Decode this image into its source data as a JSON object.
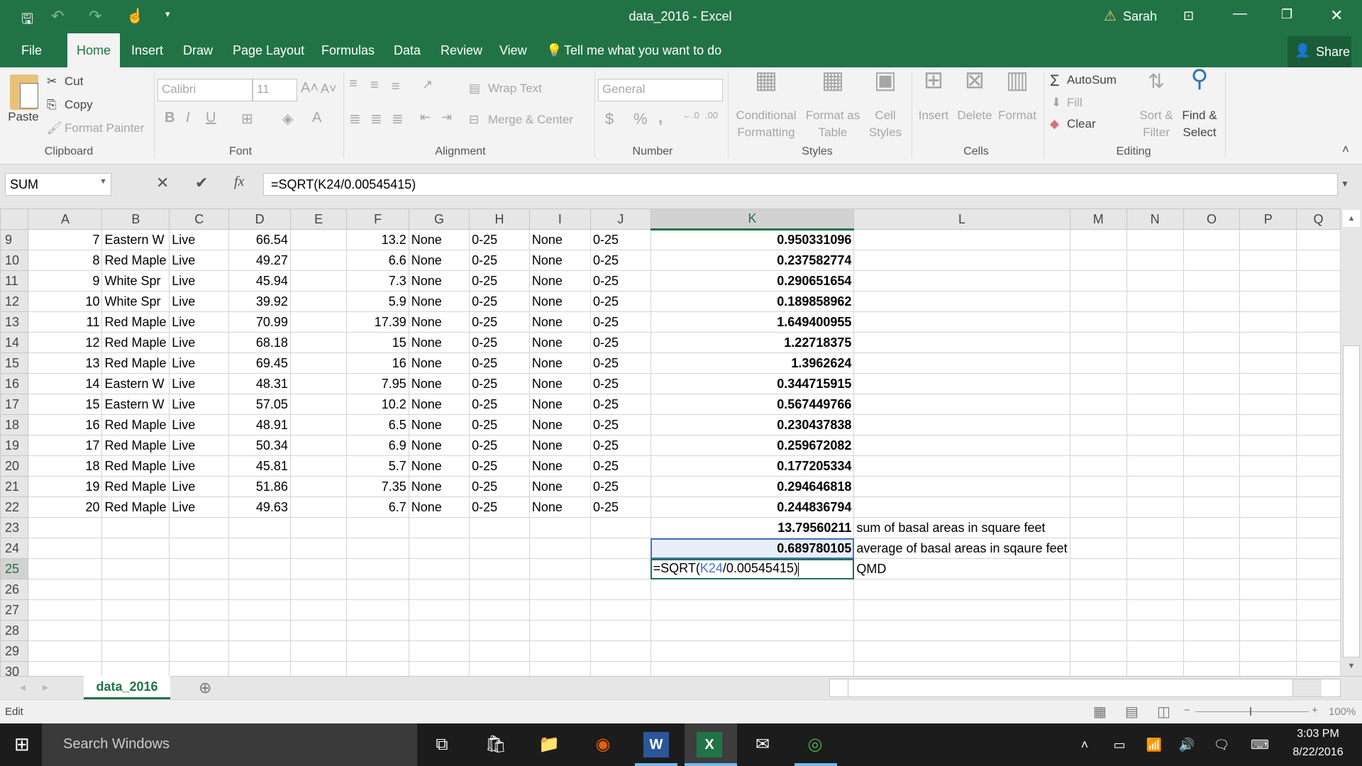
{
  "window": {
    "title": "data_2016 - Excel",
    "user": "Sarah"
  },
  "menu": {
    "file": "File",
    "tabs": [
      "Home",
      "Insert",
      "Draw",
      "Page Layout",
      "Formulas",
      "Data",
      "Review",
      "View"
    ],
    "tell_me": "Tell me what you want to do",
    "share": "Share"
  },
  "ribbon": {
    "clipboard": {
      "label": "Clipboard",
      "paste": "Paste",
      "cut": "Cut",
      "copy": "Copy",
      "format_painter": "Format Painter"
    },
    "font": {
      "label": "Font",
      "name": "Calibri",
      "size": "11"
    },
    "alignment": {
      "label": "Alignment",
      "wrap_text": "Wrap Text",
      "merge_center": "Merge & Center"
    },
    "number": {
      "label": "Number",
      "format": "General"
    },
    "styles": {
      "label": "Styles",
      "conditional": "Conditional",
      "conditional2": "Formatting",
      "format_as": "Format as",
      "format_as2": "Table",
      "cell": "Cell",
      "cell2": "Styles"
    },
    "cells": {
      "label": "Cells",
      "insert": "Insert",
      "delete": "Delete",
      "format": "Format"
    },
    "editing": {
      "label": "Editing",
      "autosum": "AutoSum",
      "fill": "Fill",
      "clear": "Clear",
      "sort": "Sort &",
      "sort2": "Filter",
      "find": "Find &",
      "find2": "Select"
    }
  },
  "formula_bar": {
    "name_box": "SUM",
    "formula": "=SQRT(K24/0.00545415)"
  },
  "sheet": {
    "columns": [
      "A",
      "B",
      "C",
      "D",
      "E",
      "F",
      "G",
      "H",
      "I",
      "J",
      "K",
      "L",
      "M",
      "N",
      "O",
      "P",
      "Q"
    ],
    "selected_column": "K",
    "active_row": "25",
    "rows": [
      {
        "n": "9",
        "A": "7",
        "B": "Eastern W",
        "C": "Live",
        "D": "66.54",
        "F": "13.2",
        "G": "None",
        "H": "0-25",
        "I": "None",
        "J": "0-25",
        "K": "0.950331096"
      },
      {
        "n": "10",
        "A": "8",
        "B": "Red Maple",
        "C": "Live",
        "D": "49.27",
        "F": "6.6",
        "G": "None",
        "H": "0-25",
        "I": "None",
        "J": "0-25",
        "K": "0.237582774"
      },
      {
        "n": "11",
        "A": "9",
        "B": "White Spr",
        "C": "Live",
        "D": "45.94",
        "F": "7.3",
        "G": "None",
        "H": "0-25",
        "I": "None",
        "J": "0-25",
        "K": "0.290651654"
      },
      {
        "n": "12",
        "A": "10",
        "B": "White Spr",
        "C": "Live",
        "D": "39.92",
        "F": "5.9",
        "G": "None",
        "H": "0-25",
        "I": "None",
        "J": "0-25",
        "K": "0.189858962"
      },
      {
        "n": "13",
        "A": "11",
        "B": "Red Maple",
        "C": "Live",
        "D": "70.99",
        "F": "17.39",
        "G": "None",
        "H": "0-25",
        "I": "None",
        "J": "0-25",
        "K": "1.649400955"
      },
      {
        "n": "14",
        "A": "12",
        "B": "Red Maple",
        "C": "Live",
        "D": "68.18",
        "F": "15",
        "G": "None",
        "H": "0-25",
        "I": "None",
        "J": "0-25",
        "K": "1.22718375"
      },
      {
        "n": "15",
        "A": "13",
        "B": "Red Maple",
        "C": "Live",
        "D": "69.45",
        "F": "16",
        "G": "None",
        "H": "0-25",
        "I": "None",
        "J": "0-25",
        "K": "1.3962624"
      },
      {
        "n": "16",
        "A": "14",
        "B": "Eastern W",
        "C": "Live",
        "D": "48.31",
        "F": "7.95",
        "G": "None",
        "H": "0-25",
        "I": "None",
        "J": "0-25",
        "K": "0.344715915"
      },
      {
        "n": "17",
        "A": "15",
        "B": "Eastern W",
        "C": "Live",
        "D": "57.05",
        "F": "10.2",
        "G": "None",
        "H": "0-25",
        "I": "None",
        "J": "0-25",
        "K": "0.567449766"
      },
      {
        "n": "18",
        "A": "16",
        "B": "Red Maple",
        "C": "Live",
        "D": "48.91",
        "F": "6.5",
        "G": "None",
        "H": "0-25",
        "I": "None",
        "J": "0-25",
        "K": "0.230437838"
      },
      {
        "n": "19",
        "A": "17",
        "B": "Red Maple",
        "C": "Live",
        "D": "50.34",
        "F": "6.9",
        "G": "None",
        "H": "0-25",
        "I": "None",
        "J": "0-25",
        "K": "0.259672082"
      },
      {
        "n": "20",
        "A": "18",
        "B": "Red Maple",
        "C": "Live",
        "D": "45.81",
        "F": "5.7",
        "G": "None",
        "H": "0-25",
        "I": "None",
        "J": "0-25",
        "K": "0.177205334"
      },
      {
        "n": "21",
        "A": "19",
        "B": "Red Maple",
        "C": "Live",
        "D": "51.86",
        "F": "7.35",
        "G": "None",
        "H": "0-25",
        "I": "None",
        "J": "0-25",
        "K": "0.294646818"
      },
      {
        "n": "22",
        "A": "20",
        "B": "Red Maple",
        "C": "Live",
        "D": "49.63",
        "F": "6.7",
        "G": "None",
        "H": "0-25",
        "I": "None",
        "J": "0-25",
        "K": "0.244836794"
      },
      {
        "n": "23",
        "K": "13.79560211",
        "L": "sum of basal areas in square feet"
      },
      {
        "n": "24",
        "K": "0.689780105",
        "L": "average of basal areas in sqaure feet"
      },
      {
        "n": "25",
        "K_edit": {
          "prefix": "=SQRT(",
          "ref": "K24",
          "suffix": "/0.00545415)"
        },
        "L": "QMD"
      },
      {
        "n": "26"
      },
      {
        "n": "27"
      },
      {
        "n": "28"
      },
      {
        "n": "29"
      },
      {
        "n": "30"
      }
    ]
  },
  "sheet_tabs": {
    "active": "data_2016"
  },
  "status": {
    "mode": "Edit",
    "zoom": "100%"
  },
  "taskbar": {
    "search": "Search Windows",
    "time": "3:03 PM",
    "date": "8/22/2016"
  },
  "colors": {
    "excel_green": "#217346",
    "ref_blue": "#4472c4",
    "selection_blue": "#e8eef8"
  }
}
